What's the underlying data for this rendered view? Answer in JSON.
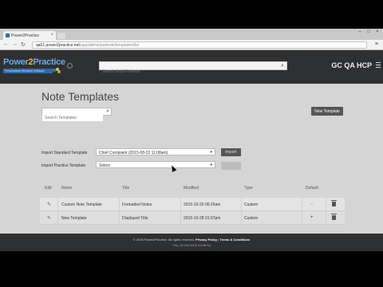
{
  "browser": {
    "tab_title": "Power2Practice",
    "url_host": "qa01.power2practice.net",
    "url_path": "/app/admin/patients/templates/list"
  },
  "header": {
    "logo_text_a": "Power",
    "logo_text_b": "2",
    "logo_text_c": "Practice",
    "logo_tagline": "Personalized Medicine Software",
    "search_placeholder": "Search Adult Patients",
    "user_name": "GC QA HCP"
  },
  "page": {
    "title": "Note Templates",
    "search_placeholder": "Search Templates",
    "new_template_label": "New Template",
    "import_standard_label": "Import Standard Template",
    "import_practice_label": "Import Practice Template",
    "standard_selected": "Chief Complaint (2015-08-22 11:08am)",
    "practice_selected": "Select",
    "import_button": "Import"
  },
  "table": {
    "headers": [
      "Edit",
      "Name",
      "Title",
      "Modified",
      "Type",
      "Default"
    ],
    "rows": [
      {
        "name": "Custom Note Template",
        "title": "Formatted Notes",
        "modified": "2015-10-20 06:26am",
        "type": "Custom",
        "default": "–"
      },
      {
        "name": "New Template",
        "title": "Displayed Title",
        "modified": "2015-10-28 01:07pm",
        "type": "Custom",
        "default": "+"
      }
    ]
  },
  "footer": {
    "copyright": "© 2015 Power2Practice. All rights reserved.",
    "privacy": "Privacy Policy",
    "divider": "|",
    "terms": "Terms & Conditions",
    "timestamp": "Thu, 29 Oct 2015 13:08:53"
  },
  "colors": {
    "header_bg": "#2f3032",
    "body_bg": "#d5d5d5",
    "accent_blue": "#2f6aa8",
    "logo_yellow": "#f0c030"
  }
}
